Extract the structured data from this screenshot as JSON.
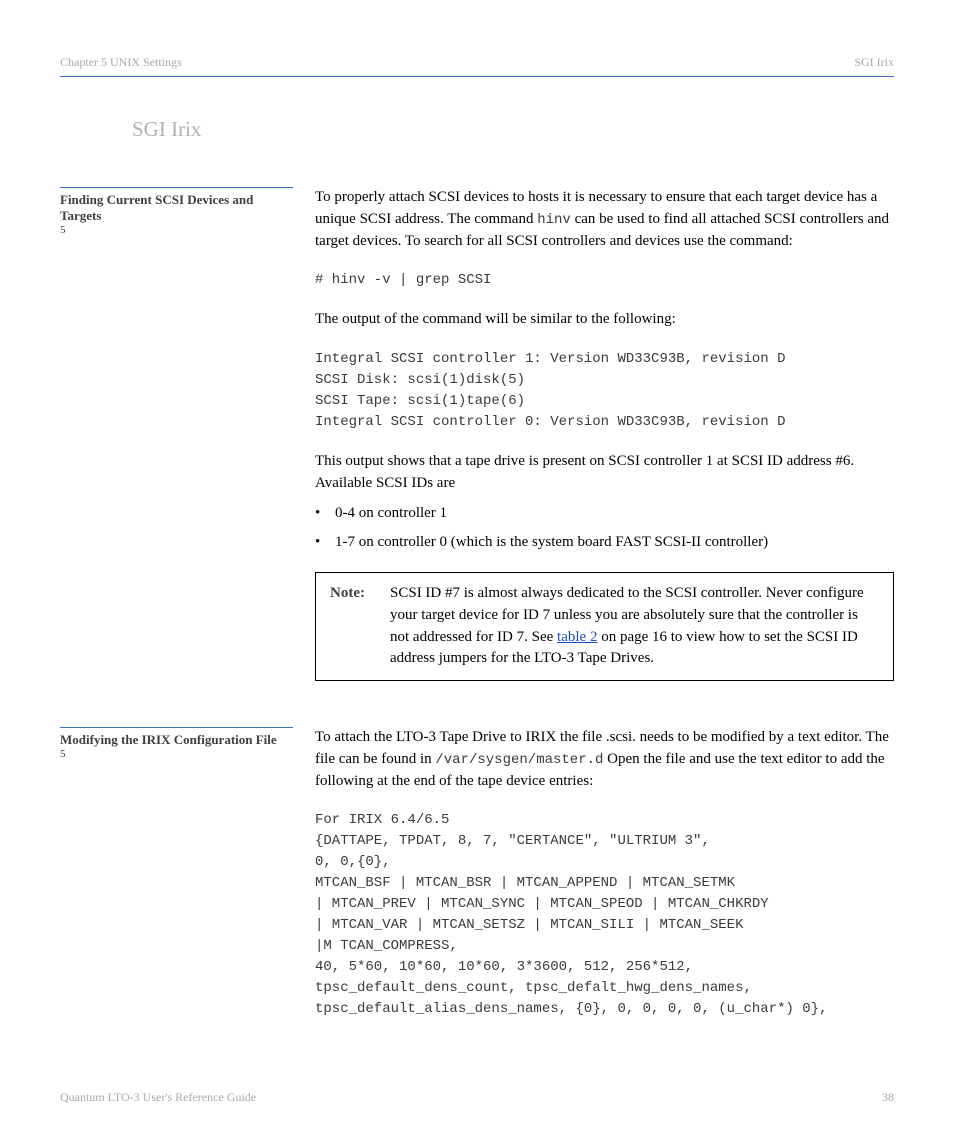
{
  "header": {
    "left": "Chapter 5  UNIX Settings",
    "right": "SGI Irix"
  },
  "chapter_title": "SGI Irix",
  "section1": {
    "label_title": "Finding Current SCSI Devices and Targets",
    "label_num": "5",
    "para1_a": "To properly attach SCSI devices to hosts it is necessary to ensure that each target device has a unique SCSI address. The command ",
    "para1_cmd": "hinv",
    "para1_b": " can be used to find all attached SCSI controllers and target devices. To search for all SCSI controllers and devices use the command:",
    "code1": "# hinv -v | grep SCSI",
    "para2": "The output of the command will be similar to the following:",
    "code2": "Integral SCSI controller 1: Version WD33C93B, revision D\nSCSI Disk: scsi(1)disk(5)\nSCSI Tape: scsi(1)tape(6)\nIntegral SCSI controller 0: Version WD33C93B, revision D",
    "para3": "This output shows that a tape drive is present on SCSI controller 1 at SCSI ID address #6. Available SCSI IDs are",
    "bullet1": "0-4 on controller 1",
    "bullet2": "1-7 on controller 0 (which is the system board FAST SCSI-II controller)"
  },
  "note": {
    "label": "Note:",
    "text_a": "SCSI ID #7 is almost always dedicated to the SCSI controller. Never configure your target device for ID 7 unless you are absolutely sure that the controller is not addressed for ID 7. See ",
    "link": "table 2",
    "text_b": " on page 16 to view how to set the SCSI ID address jumpers for the LTO-3 Tape Drives."
  },
  "section2": {
    "label_title": "Modifying the IRIX Configuration File",
    "label_num": "5",
    "para1_a": "To attach the LTO-3 Tape Drive to IRIX the file .scsi. needs to be modified by a text editor. The file can be found in ",
    "para1_path": "/var/sysgen/master.d",
    "para1_b": " Open the file and use the text editor to add the following at the end of the tape device entries:",
    "code1": "For IRIX 6.4/6.5\n{DATTAPE, TPDAT, 8, 7, \"CERTANCE\", \"ULTRIUM 3\",\n0, 0,{0},\nMTCAN_BSF | MTCAN_BSR | MTCAN_APPEND | MTCAN_SETMK\n| MTCAN_PREV | MTCAN_SYNC | MTCAN_SPEOD | MTCAN_CHKRDY\n| MTCAN_VAR | MTCAN_SETSZ | MTCAN_SILI | MTCAN_SEEK\n|M TCAN_COMPRESS,\n40, 5*60, 10*60, 10*60, 3*3600, 512, 256*512,\ntpsc_default_dens_count, tpsc_defalt_hwg_dens_names,\ntpsc_default_alias_dens_names, {0}, 0, 0, 0, 0, (u_char*) 0},"
  },
  "footer": {
    "left": "Quantum LTO-3 User's Reference Guide",
    "right": "38"
  }
}
